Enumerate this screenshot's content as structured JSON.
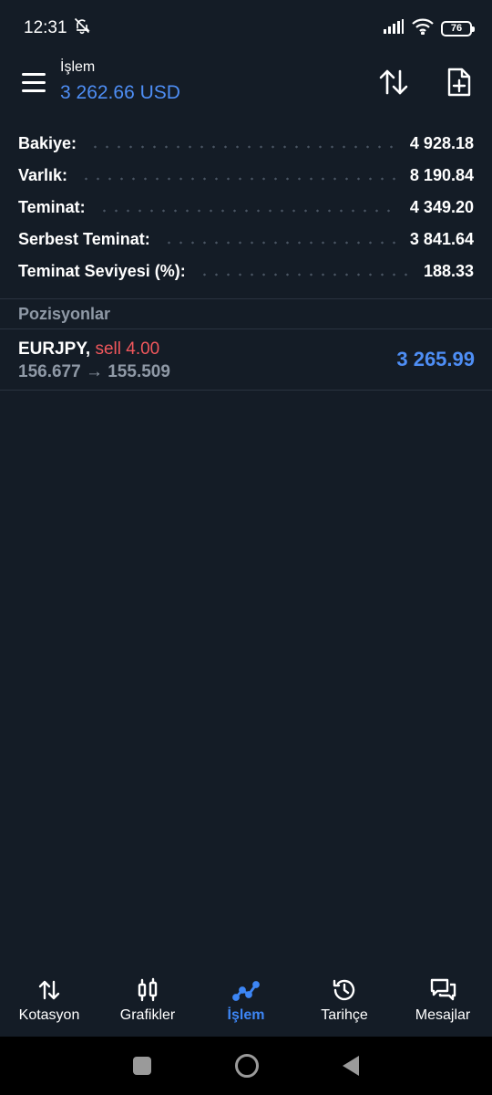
{
  "status_bar": {
    "time": "12:31",
    "battery": "76"
  },
  "header": {
    "title": "İşlem",
    "balance": "3 262.66 USD"
  },
  "summary": [
    {
      "label": "Bakiye:",
      "value": "4 928.18"
    },
    {
      "label": "Varlık:",
      "value": "8 190.84"
    },
    {
      "label": "Teminat:",
      "value": "4 349.20"
    },
    {
      "label": "Serbest Teminat:",
      "value": "3 841.64"
    },
    {
      "label": "Teminat Seviyesi (%):",
      "value": "188.33"
    }
  ],
  "positions": {
    "section_title": "Pozisyonlar",
    "items": [
      {
        "symbol": "EURJPY,",
        "side": "sell 4.00",
        "prices": "156.677 → 155.509",
        "profit": "3 265.99"
      }
    ]
  },
  "bottom_nav": [
    {
      "label": "Kotasyon",
      "icon": "quotes-arrows-icon"
    },
    {
      "label": "Grafikler",
      "icon": "candlestick-chart-icon"
    },
    {
      "label": "İşlem",
      "icon": "trade-line-icon",
      "active": true
    },
    {
      "label": "Tarihçe",
      "icon": "history-clock-icon"
    },
    {
      "label": "Mesajlar",
      "icon": "messages-chat-icon"
    }
  ],
  "colors": {
    "background": "#141c26",
    "accent_blue": "#4e8ef5",
    "sell_red": "#f0575c",
    "muted_gray": "#8f99a6"
  }
}
